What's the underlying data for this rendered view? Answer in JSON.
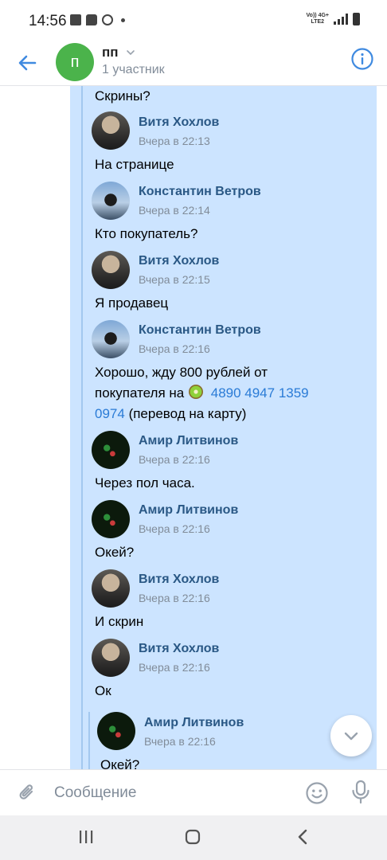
{
  "status_bar": {
    "time": "14:56",
    "network_top": "Vo)) 4G+",
    "network_bottom": "LTE2"
  },
  "header": {
    "avatar_letter": "п",
    "title": "пп",
    "subtitle": "1 участник"
  },
  "messages": {
    "top_text": "Скрины?",
    "items": [
      {
        "name": "Витя Хохлов",
        "time": "Вчера в 22:13",
        "text": "На странице"
      },
      {
        "name": "Константин Ветров",
        "time": "Вчера в 22:14",
        "text": "Кто покупатель?"
      },
      {
        "name": "Витя Хохлов",
        "time": "Вчера в 22:15",
        "text": "Я продавец"
      },
      {
        "name": "Константин Ветров",
        "time": "Вчера в 22:16",
        "text_line1": "Хорошо, жду 800 рублей от",
        "text_line2_prefix": "покупателя на",
        "card_part1": "4890 4947 1359",
        "card_part2": "0974",
        "text_line3_suffix": "(перевод на карту)"
      },
      {
        "name": "Амир Литвинов",
        "time": "Вчера в 22:16",
        "text": "Через пол часа."
      },
      {
        "name": "Амир Литвинов",
        "time": "Вчера в 22:16",
        "text": "Окей?"
      },
      {
        "name": "Витя Хохлов",
        "time": "Вчера в 22:16",
        "text": "И скрин"
      },
      {
        "name": "Витя Хохлов",
        "time": "Вчера в 22:16",
        "text": "Ок"
      },
      {
        "name": "Амир Литвинов",
        "time": "Вчера в 22:16",
        "text": "Окей?"
      }
    ]
  },
  "composer": {
    "placeholder": "Сообщение"
  },
  "colors": {
    "accent": "#2a5885",
    "link": "#2a7bd6",
    "forward_bg": "#cce4ff",
    "avatar_green": "#4bb34b",
    "meta_gray": "#818c99"
  },
  "icons": [
    "back-arrow-icon",
    "chevron-down-icon",
    "info-icon",
    "chevron-down-icon",
    "paperclip-icon",
    "smile-icon",
    "microphone-icon",
    "recent-apps-icon",
    "home-icon",
    "back-icon"
  ]
}
